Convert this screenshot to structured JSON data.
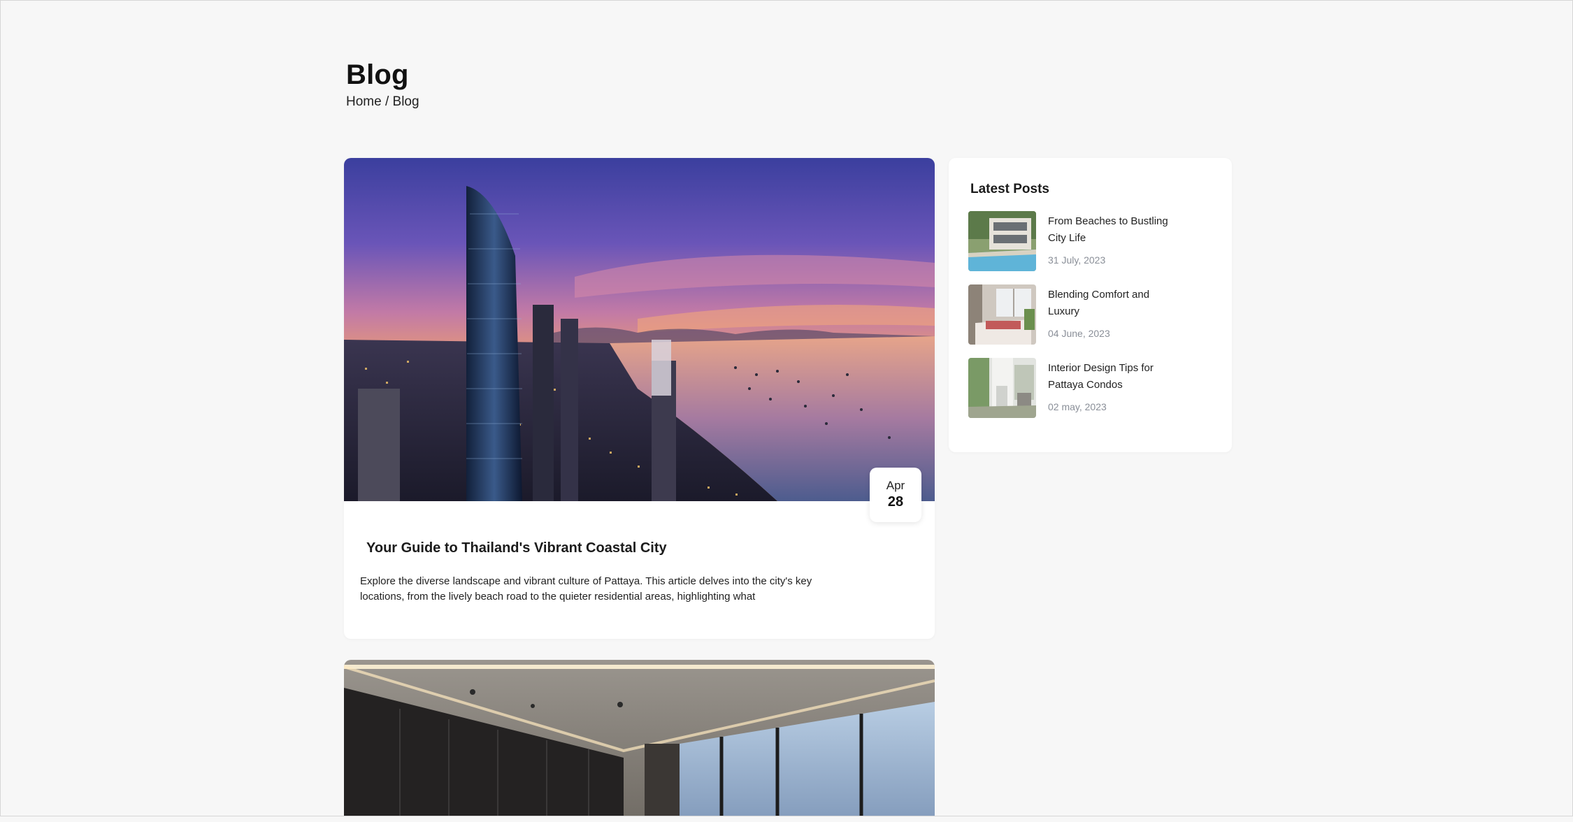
{
  "page": {
    "title": "Blog",
    "breadcrumb": {
      "home": "Home",
      "separator": " / ",
      "current": "Blog"
    }
  },
  "featured_post": {
    "date_month": "Apr",
    "date_day": "28",
    "title": "Your Guide to Thailand's Vibrant Coastal City",
    "excerpt": "Explore the diverse landscape and vibrant culture of Pattaya. This article delves into the city's key locations, from the lively beach road to the quieter residential areas, highlighting what"
  },
  "sidebar": {
    "title": "Latest Posts",
    "items": [
      {
        "title": "From Beaches to Bustling City Life",
        "date": "31 July, 2023"
      },
      {
        "title": "Blending Comfort and Luxury",
        "date": "04 June, 2023"
      },
      {
        "title": "Interior Design Tips for Pattaya Condos",
        "date": "02 may, 2023"
      }
    ]
  },
  "colors": {
    "background": "#f7f7f7",
    "card": "#ffffff",
    "date_text": "#8a8f98"
  }
}
